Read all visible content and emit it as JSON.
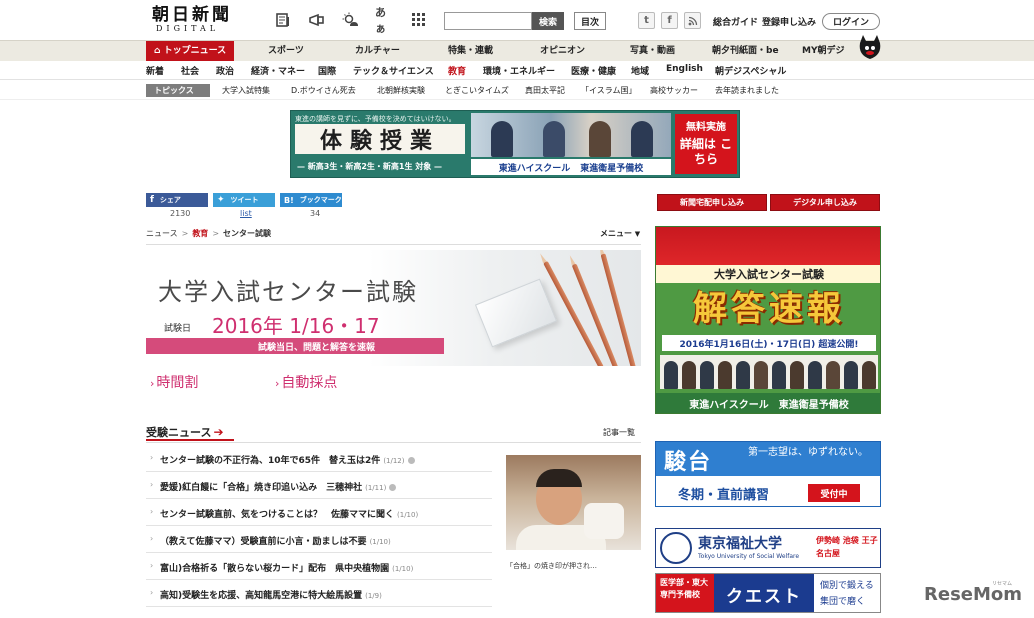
{
  "header": {
    "logo_main": "朝日新聞",
    "logo_sub": "DIGITAL",
    "search_placeholder": "",
    "search_button": "検索",
    "toc_button": "目次",
    "links": [
      "総合ガイド",
      "登録申し込み"
    ],
    "login_button": "ログイン"
  },
  "main_nav": [
    "トップニュース",
    "スポーツ",
    "カルチャー",
    "特集・連載",
    "オピニオン",
    "写真・動画",
    "朝夕刊紙面・be",
    "MY朝デジ"
  ],
  "sub_nav": [
    "新着",
    "社会",
    "政治",
    "経済・マネー",
    "国際",
    "テック＆サイエンス",
    "教育",
    "環境・エネルギー",
    "医療・健康",
    "地域",
    "English",
    "朝デジスペシャル"
  ],
  "topics": {
    "label": "トピックス",
    "items": [
      "大学入試特集",
      "D.ボウイさん死去",
      "北朝鮮核実験",
      "とぎこいタイムズ",
      "真田太平記",
      "「イスラム国」",
      "高校サッカー",
      "去年読まれました"
    ]
  },
  "top_ad": {
    "headline": "東進の講師を見ずに、予備校を決めてはいけない。",
    "title": "体験授業",
    "subtitle": "— 新高3生・新高2生・新高1生 対象 —",
    "brand1": "東進ハイスクール",
    "brand2": "東進衛星予備校",
    "cta_top": "無料実施",
    "cta_bottom": "詳細は こちら"
  },
  "share": {
    "facebook_label": "シェア",
    "facebook_count": "2130",
    "twitter_label": "ツイート",
    "twitter_count": "list",
    "hatena_label": "ブックマーク",
    "hatena_count": "34"
  },
  "breadcrumb": [
    "ニュース",
    "教育",
    "センター試験"
  ],
  "menu_label": "メニュー",
  "hero": {
    "title": "大学入試センター試験",
    "date_label": "試験日",
    "date_value": "2016年 1/16・17",
    "bar_text": "試験当日、問題と解答を速報"
  },
  "quick_links": [
    "時間割",
    "自動採点"
  ],
  "news": {
    "heading": "受験ニュース",
    "all_link": "記事一覧",
    "items": [
      {
        "title": "センター試験の不正行為、10年で65件　替え玉は2件",
        "date": "(1/12)",
        "photo": true
      },
      {
        "title": "愛媛)紅白饅に「合格」焼き印追い込み　三穂神社",
        "date": "(1/11)",
        "photo": true
      },
      {
        "title": "センター試験直前、気をつけることは？　佐藤ママに聞く",
        "date": "(1/10)",
        "photo": false
      },
      {
        "title": "（教えて佐藤ママ）受験直前に小言・励ましは不要",
        "date": "(1/10)",
        "photo": false
      },
      {
        "title": "富山)合格祈る「散らない桜カード」配布　県中央植物園",
        "date": "(1/10)",
        "photo": false
      },
      {
        "title": "高知)受験生を応援、高知龍馬空港に特大絵馬設置",
        "date": "(1/9)",
        "photo": false
      }
    ],
    "photo_caption": "「合格」の焼き印が押され…"
  },
  "right": {
    "buttons": [
      "新聞宅配申し込み",
      "デジタル申し込み"
    ],
    "ad1": {
      "label": "大学入試センター試験",
      "big": "解答速報",
      "date": "2016年1月16日(土)・17日(日) 超速公開!",
      "brand1": "東進ハイスクール",
      "brand2": "東進衛星予備校"
    },
    "ad2": {
      "name": "駿台",
      "tagline": "第一志望は、ゆずれない。",
      "sub": "冬期・直前講習",
      "button": "受付中"
    },
    "ad3": {
      "name": "東京福祉大学",
      "en": "Tokyo University of Social Welfare",
      "locations": "伊勢崎 池袋 王子 名古屋"
    },
    "ad4": {
      "left": "医学部・東大 専門予備校",
      "mid": "クエスト",
      "right1": "個別で鍛える",
      "right2": "集団で磨く"
    }
  },
  "watermark": "ReseMom",
  "watermark_sub": "リセマム",
  "colors": {
    "brand_red": "#c1121a",
    "pink_accent": "#cf2f6f",
    "nav_bg": "#eceae1",
    "facebook": "#3b5a98",
    "twitter": "#3a9fd8"
  }
}
